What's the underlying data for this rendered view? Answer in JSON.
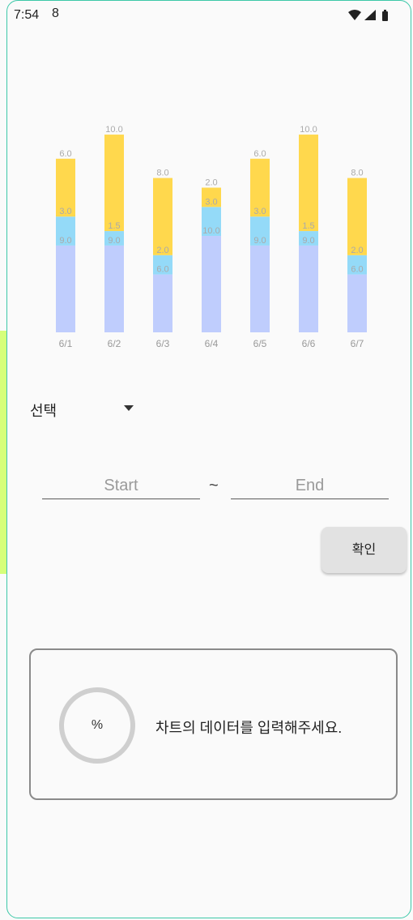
{
  "status_bar": {
    "time": "7:54",
    "sim_glyph": "8"
  },
  "chart_data": {
    "type": "bar",
    "stacked": true,
    "categories": [
      "6/1",
      "6/2",
      "6/3",
      "6/4",
      "6/5",
      "6/6",
      "6/7"
    ],
    "series": [
      {
        "values": [
          9.0,
          9.0,
          6.0,
          10.0,
          9.0,
          9.0,
          6.0
        ],
        "color": "#bfcdfd"
      },
      {
        "values": [
          3.0,
          1.5,
          2.0,
          3.0,
          3.0,
          1.5,
          2.0
        ],
        "color": "#94daf8"
      },
      {
        "values": [
          6.0,
          10.0,
          8.0,
          2.0,
          6.0,
          10.0,
          8.0
        ],
        "color": "#ffd84d"
      }
    ],
    "value_labels": [
      [
        "9.0",
        "9.0",
        "6.0",
        "10.0",
        "9.0",
        "9.0",
        "6.0"
      ],
      [
        "3.0",
        "1.5",
        "2.0",
        "3.0",
        "3.0",
        "1.5",
        "2.0"
      ],
      [
        "6.0",
        "10.0",
        "8.0",
        "2.0",
        "6.0",
        "10.0",
        "8.0"
      ]
    ]
  },
  "select": {
    "label": "선택"
  },
  "date_range": {
    "start_placeholder": "Start",
    "separator": "~",
    "end_placeholder": "End"
  },
  "confirm_button": {
    "label": "확인"
  },
  "progress_card": {
    "percent_text": "%",
    "message": "차트의 데이터를 입력해주세요."
  }
}
